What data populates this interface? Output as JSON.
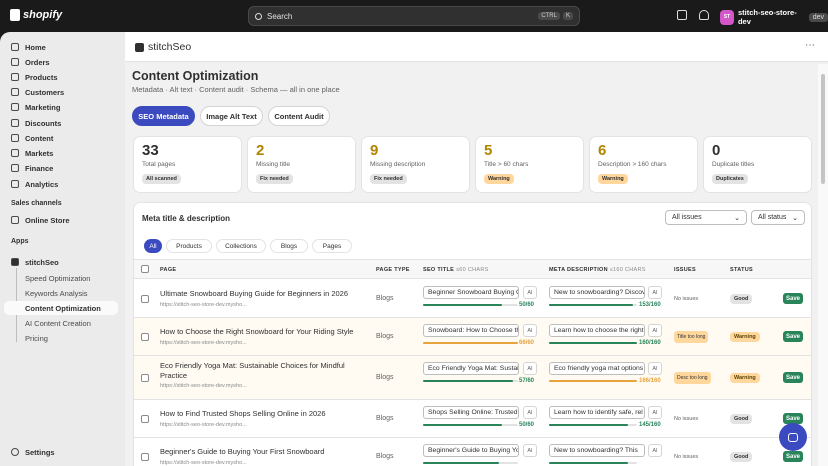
{
  "topbar": {
    "brand": "shopify",
    "search_placeholder": "Search",
    "kbd1": "CTRL",
    "kbd2": "K",
    "store_initials": "ST",
    "store_name": "stitch-seo-store-dev",
    "store_badge": "dev"
  },
  "sidebar": {
    "items": [
      "Home",
      "Orders",
      "Products",
      "Customers",
      "Marketing",
      "Discounts",
      "Content",
      "Markets",
      "Finance",
      "Analytics"
    ],
    "sales_channels": "Sales channels",
    "online_store": "Online Store",
    "apps": "Apps",
    "app_name": "stitchSeo",
    "app_items": [
      "Speed Optimization",
      "Keywords Analysis",
      "Content Optimization",
      "AI Content Creation",
      "Pricing"
    ],
    "settings": "Settings"
  },
  "app": {
    "name": "stitchSeo"
  },
  "page": {
    "title": "Content Optimization",
    "subtitle": "Metadata · Alt text · Content audit · Schema — all in one place",
    "tabs": [
      "SEO Metadata",
      "Image Alt Text",
      "Content Audit"
    ]
  },
  "stats": [
    {
      "num": "33",
      "label": "Total pages",
      "badge": "All scanned",
      "color": "#303030",
      "badge_bg": "#e3e3e3"
    },
    {
      "num": "2",
      "label": "Missing title",
      "badge": "Fix needed",
      "color": "#b28400",
      "badge_bg": "#e3e3e3"
    },
    {
      "num": "9",
      "label": "Missing description",
      "badge": "Fix needed",
      "color": "#b28400",
      "badge_bg": "#e3e3e3"
    },
    {
      "num": "5",
      "label": "Title > 60 chars",
      "badge": "Warning",
      "color": "#b28400",
      "badge_bg": "#ffd79d"
    },
    {
      "num": "6",
      "label": "Description > 160 chars",
      "badge": "Warning",
      "color": "#b28400",
      "badge_bg": "#ffd79d"
    },
    {
      "num": "0",
      "label": "Duplicate titles",
      "badge": "Duplicates",
      "color": "#303030",
      "badge_bg": "#e3e3e3"
    }
  ],
  "table": {
    "title": "Meta title & description",
    "filter_issues": "All issues",
    "filter_status": "All status",
    "pills": [
      "All",
      "Products",
      "Collections",
      "Blogs",
      "Pages"
    ],
    "headers": {
      "page": "PAGE",
      "type": "PAGE TYPE",
      "seo_title": "SEO TITLE",
      "seo_title_hint": "≤60 CHARS",
      "meta": "META DESCRIPTION",
      "meta_hint": "≤160 CHARS",
      "issues": "ISSUES",
      "status": "STATUS"
    },
    "ai_label": "AI",
    "save_label": "Save",
    "rows": [
      {
        "title": "Ultimate Snowboard Buying Guide for Beginners in 2026",
        "url": "https://stitch-seo-store-dev.mysho...",
        "type": "Blogs",
        "seo": "Beginner Snowboard Buying Guide",
        "seo_count": "50/60",
        "seo_frac": 0.83,
        "seo_color": "#29845a",
        "meta": "New to snowboarding? Discover",
        "meta_count": "153/160",
        "meta_frac": 0.96,
        "meta_color": "#29845a",
        "issues": "No issues",
        "issue_badge": false,
        "status": "Good",
        "warn": false
      },
      {
        "title": "How to Choose the Right Snowboard for Your Riding Style",
        "url": "https://stitch-seo-store-dev.mysho...",
        "type": "Blogs",
        "seo": "Snowboard: How to Choose the Right",
        "seo_count": "66/60",
        "seo_frac": 1,
        "seo_color": "#e8a33d",
        "meta": "Learn how to choose the right",
        "meta_count": "160/160",
        "meta_frac": 1,
        "meta_color": "#29845a",
        "issues": "Title too long",
        "issue_badge": true,
        "status": "Warning",
        "warn": true
      },
      {
        "title": "Eco Friendly Yoga Mat: Sustainable Choices for Mindful Practice",
        "url": "https://stitch-seo-store-dev.mysho...",
        "type": "Blogs",
        "seo": "Eco Friendly Yoga Mat: Sustainable",
        "seo_count": "57/60",
        "seo_frac": 0.95,
        "seo_color": "#29845a",
        "meta": "Eco friendly yoga mat options",
        "meta_count": "166/160",
        "meta_frac": 1,
        "meta_color": "#e8a33d",
        "issues": "Desc too long",
        "issue_badge": true,
        "status": "Warning",
        "warn": true
      },
      {
        "title": "How to Find Trusted Shops Selling Online in 2026",
        "url": "https://stitch-seo-store-dev.mysho...",
        "type": "Blogs",
        "seo": "Shops Selling Online: Trusted",
        "seo_count": "50/60",
        "seo_frac": 0.83,
        "seo_color": "#29845a",
        "meta": "Learn how to identify safe, rel",
        "meta_count": "145/160",
        "meta_frac": 0.9,
        "meta_color": "#29845a",
        "issues": "No issues",
        "issue_badge": false,
        "status": "Good",
        "warn": false
      },
      {
        "title": "Beginner's Guide to Buying Your First Snowboard",
        "url": "https://stitch-seo-store-dev.mysho...",
        "type": "Blogs",
        "seo": "Beginner's Guide to Buying Your",
        "seo_count": "",
        "seo_frac": 0.8,
        "seo_color": "#29845a",
        "meta": "New to snowboarding? This",
        "meta_count": "",
        "meta_frac": 0.9,
        "meta_color": "#29845a",
        "issues": "No issues",
        "issue_badge": false,
        "status": "Good",
        "warn": false
      }
    ]
  }
}
